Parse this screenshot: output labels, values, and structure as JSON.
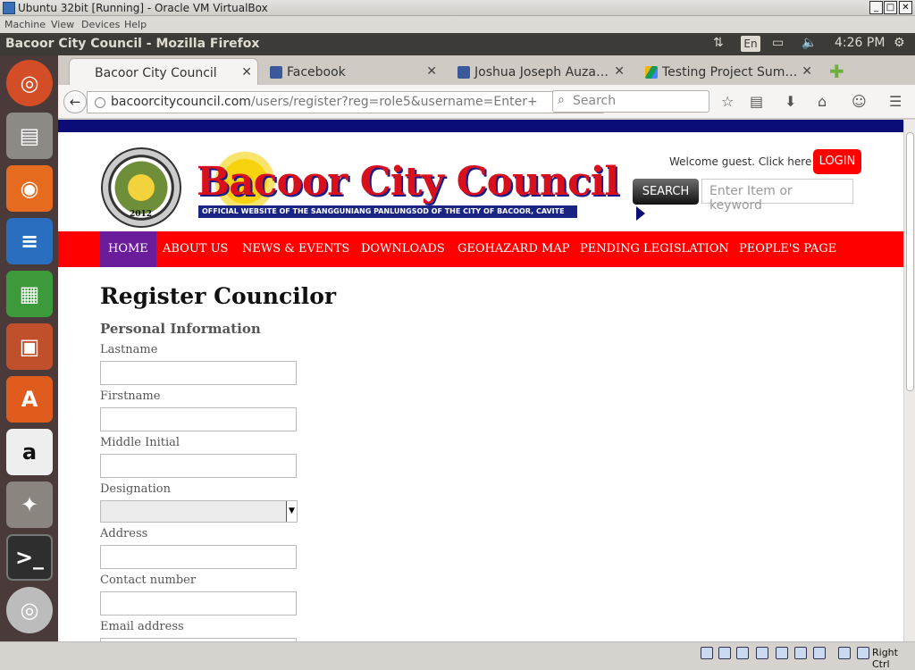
{
  "vbox": {
    "title": "Ubuntu 32bit [Running] - Oracle VM VirtualBox",
    "menu": [
      "Machine",
      "View",
      "Devices",
      "Help"
    ],
    "host_key": "Right Ctrl"
  },
  "ubuntu_panel": {
    "window_title": "Bacoor City Council - Mozilla Firefox",
    "keyboard_layout": "En",
    "clock": "4:26 PM"
  },
  "launcher": {
    "items": [
      "ubuntu-dash-icon",
      "files-icon",
      "firefox-icon",
      "writer-icon",
      "calc-icon",
      "impress-icon",
      "software-center-icon",
      "amazon-icon",
      "system-settings-icon",
      "terminal-icon",
      "dvd-icon"
    ]
  },
  "browser": {
    "tabs": [
      {
        "label": "Bacoor City Council",
        "active": true
      },
      {
        "label": "Facebook",
        "active": false
      },
      {
        "label": "Joshua Joseph Auza…",
        "active": false
      },
      {
        "label": "Testing Project Sum…",
        "active": false
      }
    ],
    "url_host": "bacoorcitycouncil.com",
    "url_path": "/users/register?reg=role5&username=Enter+",
    "search_placeholder": "Search"
  },
  "site": {
    "brand": "Bacoor City Council",
    "tagline": "OFFICIAL WEBSITE OF THE SANGGUNIANG PANLUNGSOD OF THE CITY OF BACOOR, CAVITE",
    "seal_year": "2012",
    "welcome": "Welcome guest. Click here to",
    "login": "LOGIN",
    "search_button": "SEARCH",
    "search_placeholder": "Enter Item or keyword",
    "nav": [
      "HOME",
      "ABOUT US",
      "NEWS & EVENTS",
      "DOWNLOADS",
      "GEOHAZARD MAP",
      "PENDING LEGISLATION",
      "PEOPLE'S PAGE"
    ],
    "active_nav": "HOME",
    "colors": {
      "topbar": "#0c0c78",
      "menubar": "#ff0000",
      "active_nav": "#6a1c9a",
      "login": "#ff0000"
    }
  },
  "form": {
    "title": "Register Councilor",
    "section": "Personal Information",
    "fields": {
      "lastname": {
        "label": "Lastname",
        "value": ""
      },
      "firstname": {
        "label": "Firstname",
        "value": ""
      },
      "middle_initial": {
        "label": "Middle Initial",
        "value": ""
      },
      "designation": {
        "label": "Designation",
        "value": ""
      },
      "address": {
        "label": "Address",
        "value": ""
      },
      "contact": {
        "label": "Contact number",
        "value": ""
      },
      "email": {
        "label": "Email address",
        "value": ""
      }
    }
  }
}
